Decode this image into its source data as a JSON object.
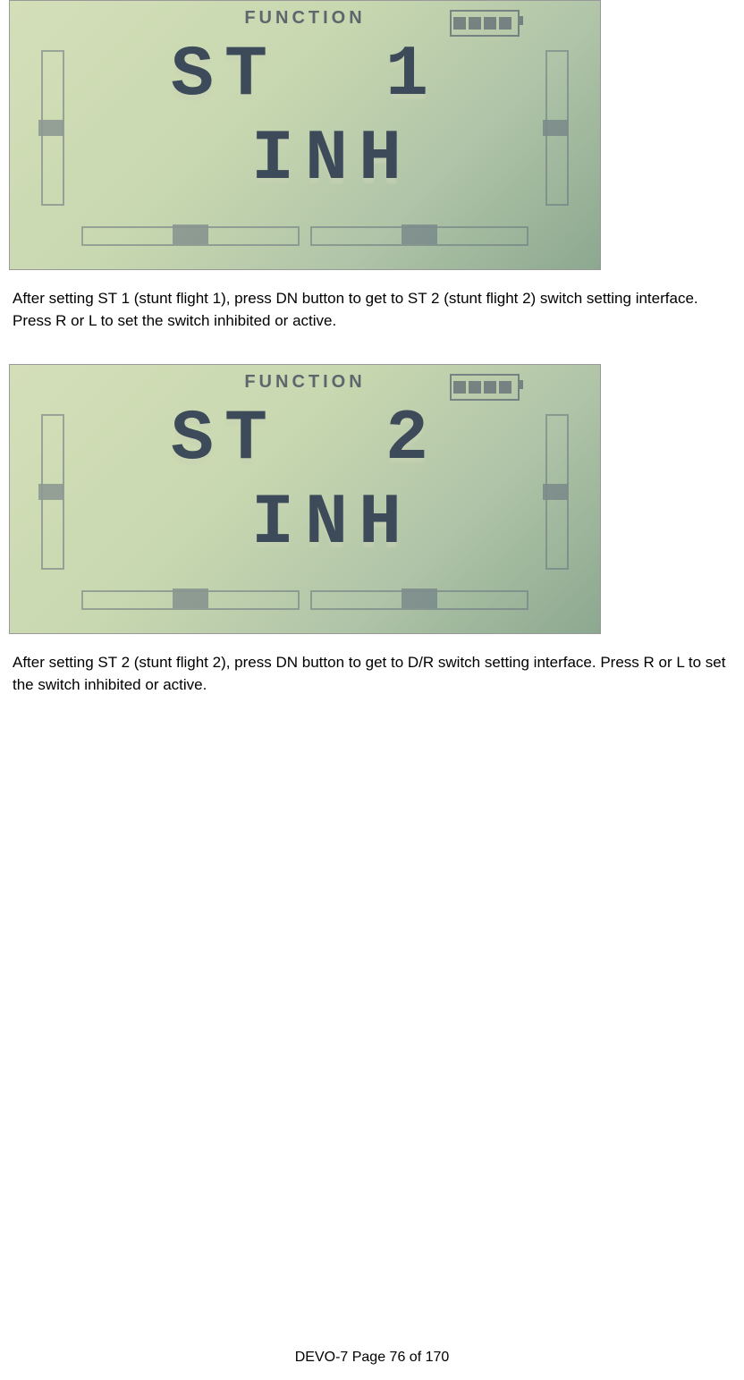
{
  "screens": {
    "s1": {
      "title": "FUNCTION",
      "line1": "ST  1",
      "line2": " INH"
    },
    "s2": {
      "title": "FUNCTION",
      "line1": "ST  2",
      "line2": " INH"
    }
  },
  "paragraphs": {
    "p1": "After setting ST 1 (stunt flight 1), press DN button to get to ST 2 (stunt flight 2) switch setting interface. Press R or L to set the switch inhibited or active.",
    "p2": "After setting ST 2 (stunt flight 2), press DN button to get to D/R switch setting interface. Press R or L to set the switch inhibited or active."
  },
  "footer": "DEVO-7     Page 76 of 170"
}
